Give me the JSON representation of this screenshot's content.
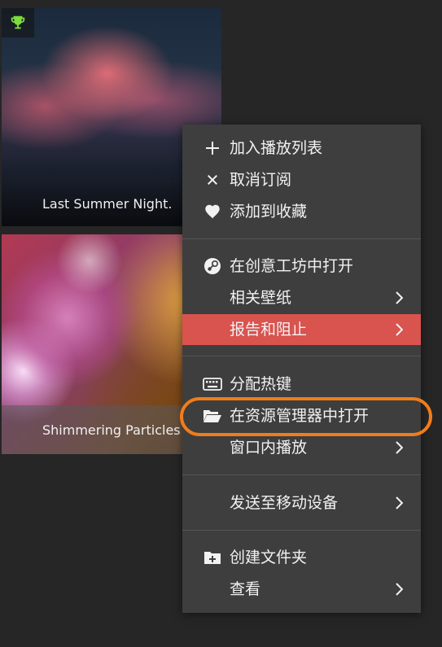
{
  "wallpapers": [
    {
      "title": "Last Summer Night."
    },
    {
      "title": "Shimmering Particles"
    }
  ],
  "menu": {
    "groups": [
      [
        {
          "label": "加入播放列表",
          "icon": "plus-icon"
        },
        {
          "label": "取消订阅",
          "icon": "close-icon"
        },
        {
          "label": "添加到收藏",
          "icon": "heart-icon"
        }
      ],
      [
        {
          "label": "在创意工坊中打开",
          "icon": "steam-icon"
        },
        {
          "label": "相关壁纸",
          "submenu": true
        },
        {
          "label": "报告和阻止",
          "submenu": true,
          "active": true
        }
      ],
      [
        {
          "label": "分配热键",
          "icon": "keyboard-icon"
        },
        {
          "label": "在资源管理器中打开",
          "icon": "folder-open-icon",
          "highlighted": true
        },
        {
          "label": "窗口内播放",
          "submenu": true
        }
      ],
      [
        {
          "label": "发送至移动设备",
          "submenu": true
        }
      ],
      [
        {
          "label": "创建文件夹",
          "icon": "folder-add-icon"
        },
        {
          "label": "查看",
          "submenu": true
        }
      ]
    ]
  },
  "colors": {
    "menu_bg": "#3e3e3e",
    "active_bg": "#d9534f",
    "highlight_ring": "#f07d1a",
    "trophy": "#7ddc3a"
  }
}
